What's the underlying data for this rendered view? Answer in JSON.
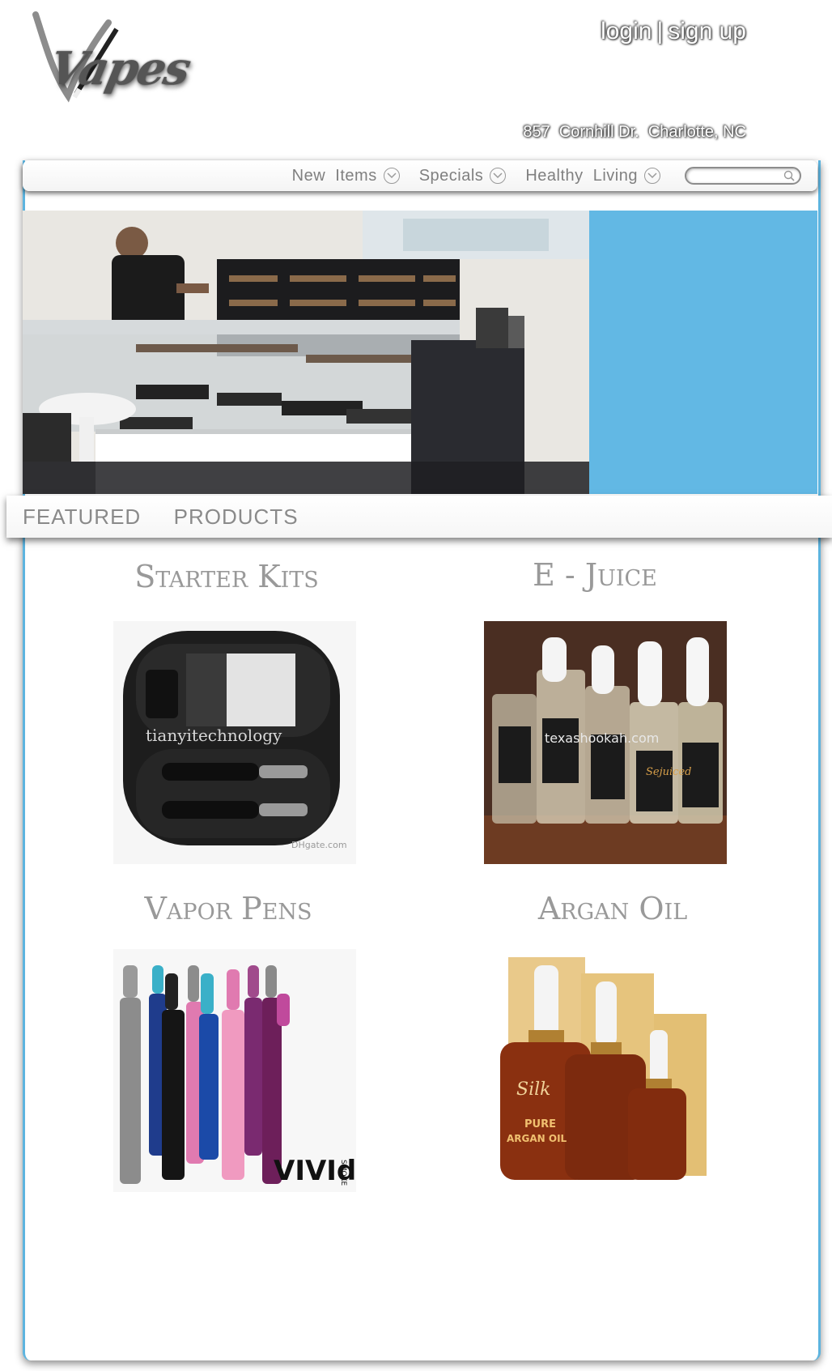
{
  "brand": {
    "logo_text": "Vapes"
  },
  "header": {
    "login_label": "login",
    "separator": "|",
    "signup_label": "sign up",
    "address": "857  Cornhill Dr.  Charlotte, NC"
  },
  "nav": {
    "items": [
      {
        "label": "New  Items"
      },
      {
        "label": "Specials"
      },
      {
        "label": "Healthy  Living"
      }
    ],
    "search": {
      "placeholder": ""
    }
  },
  "hero": {
    "accent_color": "#62b8e4"
  },
  "featured": {
    "title": "FEATURED  PRODUCTS"
  },
  "products": [
    {
      "title": "Starter Kits",
      "image_caption": "tianyitechnology",
      "image_watermark": "DHgate.com"
    },
    {
      "title": "E - Juice",
      "image_caption": "texashookah.com",
      "bottle_label": "Sejuiced"
    },
    {
      "title": "Vapor Pens",
      "brand_text": "VIVId",
      "brand_sub": "SMOKE"
    },
    {
      "title": "Argan Oil",
      "bottle_brand": "Silk",
      "bottle_line1": "PURE",
      "bottle_line2": "ARGAN OIL"
    }
  ]
}
